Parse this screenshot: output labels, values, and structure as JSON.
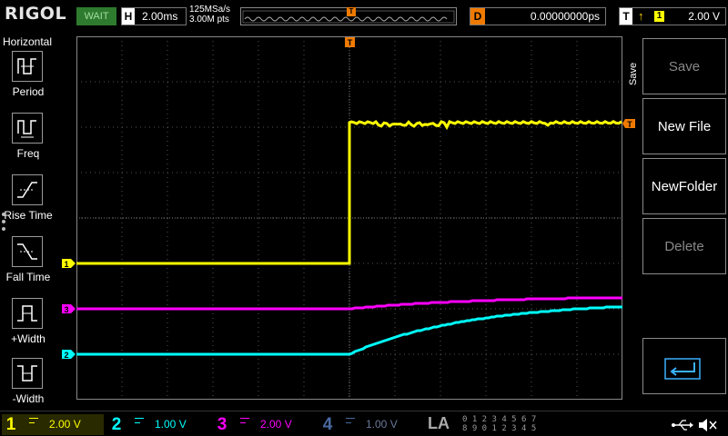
{
  "brand": "RIGOL",
  "run_state": "WAIT",
  "horizontal": {
    "label": "H",
    "timebase": "2.00ms",
    "sample_rate": "125MSa/s",
    "memory_depth": "3.00M pts"
  },
  "trigger_marker": "T",
  "delay": {
    "label": "D",
    "value": "0.00000000ps"
  },
  "trigger": {
    "label": "T",
    "edge_icon": "rising-edge-icon",
    "edge_symbol": "↑",
    "source": "1",
    "level": "2.00 V"
  },
  "left_menu": {
    "title": "Horizontal",
    "items": [
      {
        "label": "Period",
        "icon": "period-icon"
      },
      {
        "label": "Freq",
        "icon": "freq-icon"
      },
      {
        "label": "Rise Time",
        "icon": "rise-time-icon"
      },
      {
        "label": "Fall Time",
        "icon": "fall-time-icon"
      },
      {
        "label": "+Width",
        "icon": "plus-width-icon"
      },
      {
        "label": "-Width",
        "icon": "minus-width-icon"
      }
    ]
  },
  "right_menu": {
    "title": "Save",
    "buttons": [
      {
        "label": "Save",
        "enabled": false
      },
      {
        "label": "New File",
        "enabled": true
      },
      {
        "label": "NewFolder",
        "enabled": true
      },
      {
        "label": "Delete",
        "enabled": false
      },
      {
        "label": "",
        "icon": "enter-icon",
        "enabled": true
      }
    ]
  },
  "channels": [
    {
      "number": "1",
      "scale": "2.00 V",
      "color": "#ffff00",
      "enabled": true
    },
    {
      "number": "2",
      "scale": "1.00 V",
      "color": "#00ffff",
      "enabled": true
    },
    {
      "number": "3",
      "scale": "2.00 V",
      "color": "#ff00ff",
      "enabled": true
    },
    {
      "number": "4",
      "scale": "1.00 V",
      "color": "#4a6aa0",
      "enabled": false
    }
  ],
  "la": {
    "label": "LA",
    "digits_row1": "0 1 2 3  4 5 6 7",
    "digits_row2": "8 9 0 1  2 3 4 5"
  },
  "status_icons": [
    "usb-icon",
    "speaker-muted-icon"
  ],
  "colors": {
    "ch1": "#ffff00",
    "ch2": "#00ffff",
    "ch3": "#ff00ff",
    "ch4": "#4a6aa0",
    "trigger": "#f07a00",
    "wait": "#2e7a2e"
  },
  "waveforms": {
    "ch1": {
      "before_trigger_level_div": -1.0,
      "after_trigger_level_div": 2.1
    },
    "ch2": {
      "before_trigger_level_div": -3.0,
      "final_level_div": -1.95
    },
    "ch3": {
      "before_trigger_level_div": -2.0,
      "final_level_div": -1.75
    }
  }
}
